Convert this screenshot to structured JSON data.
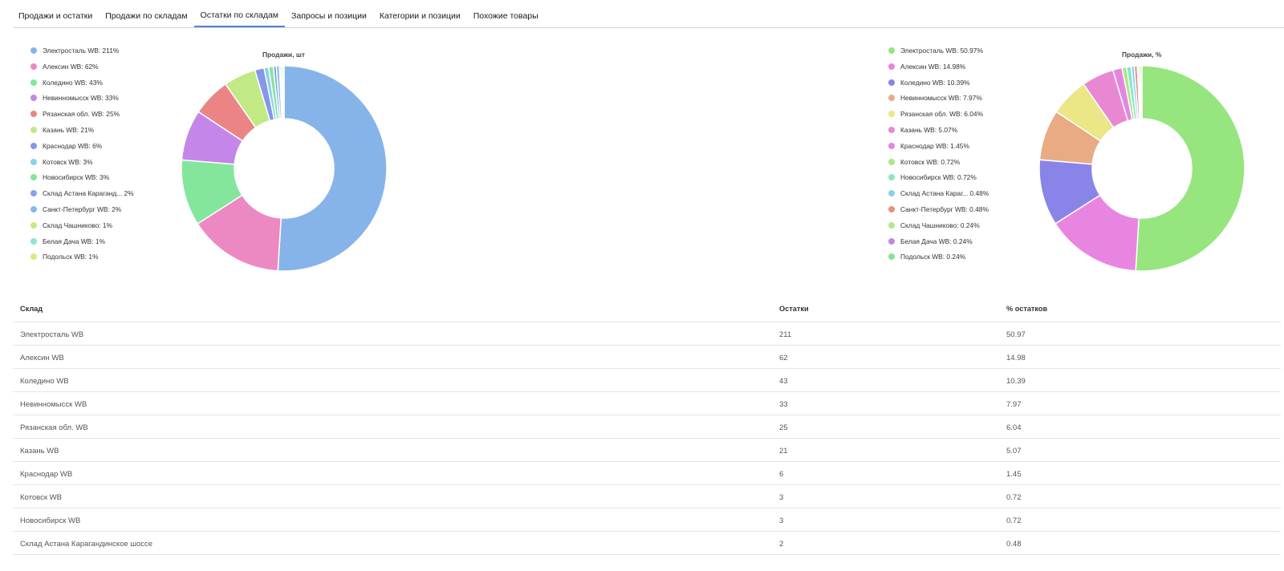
{
  "tabs": [
    {
      "label": "Продажи и остатки",
      "active": false
    },
    {
      "label": "Продажи по складам",
      "active": false
    },
    {
      "label": "Остатки по складам",
      "active": true
    },
    {
      "label": "Запросы и позиции",
      "active": false
    },
    {
      "label": "Категории и позиции",
      "active": false
    },
    {
      "label": "Похожие товары",
      "active": false
    }
  ],
  "chart_data": [
    {
      "type": "pie",
      "title": "Продажи, шт",
      "legend_position": "left",
      "labels": [
        "Электросталь WB: 211%",
        "Алексин WB: 62%",
        "Коледино WB: 43%",
        "Невинномысск WB: 33%",
        "Рязанская обл. WB: 25%",
        "Казань WB: 21%",
        "Краснодар WB: 6%",
        "Котовск WB: 3%",
        "Новосибирск WB: 3%",
        "Склад Астана Караганд...  2%",
        "Санкт-Петербург WB: 2%",
        "Склад Чашниково: 1%",
        "Белая Дача WB: 1%",
        "Подольск WB: 1%"
      ],
      "values": [
        211,
        62,
        43,
        33,
        25,
        21,
        6,
        3,
        3,
        2,
        2,
        1,
        1,
        1
      ],
      "colors": [
        "#86b4ea",
        "#ec89c2",
        "#84e69c",
        "#c486e8",
        "#eb8585",
        "#c1ea86",
        "#8597ea",
        "#8bd1ea",
        "#86e39b",
        "#87a2e8",
        "#82bce6",
        "#c6e985",
        "#8ae6cd",
        "#dde87f"
      ]
    },
    {
      "type": "pie",
      "title": "Продажи, %",
      "legend_position": "left",
      "labels": [
        "Электросталь WB: 50.97%",
        "Алексин WB: 14.98%",
        "Коледино WB: 10.39%",
        "Невинномысск WB: 7.97%",
        "Рязанская обл. WB: 6.04%",
        "Казань WB: 5.07%",
        "Краснодар WB: 1.45%",
        "Котовск WB: 0.72%",
        "Новосибирск WB: 0.72%",
        "Склад Астана Караг...  0.48%",
        "Санкт-Петербург WB: 0.48%",
        "Склад Чашниково: 0.24%",
        "Белая Дача WB: 0.24%",
        "Подольск WB: 0.24%"
      ],
      "values": [
        50.97,
        14.98,
        10.39,
        7.97,
        6.04,
        5.07,
        1.45,
        0.72,
        0.72,
        0.48,
        0.48,
        0.24,
        0.24,
        0.24
      ],
      "colors": [
        "#96e57f",
        "#e885e1",
        "#8884e8",
        "#e9ab84",
        "#ebe686",
        "#e888d2",
        "#e486e0",
        "#aae787",
        "#87e8c4",
        "#88d1ec",
        "#ec8f81",
        "#b5e787",
        "#be87e8",
        "#86e591"
      ]
    }
  ],
  "table": {
    "headers": [
      "Склад",
      "Остатки",
      "% остатков"
    ],
    "rows": [
      [
        "Электросталь WB",
        "211",
        "50.97"
      ],
      [
        "Алексин WB",
        "62",
        "14.98"
      ],
      [
        "Коледино WB",
        "43",
        "10.39"
      ],
      [
        "Невинномысск WB",
        "33",
        "7.97"
      ],
      [
        "Рязанская обл. WB",
        "25",
        "6.04"
      ],
      [
        "Казань WB",
        "21",
        "5.07"
      ],
      [
        "Краснодар WB",
        "6",
        "1.45"
      ],
      [
        "Котовск WB",
        "3",
        "0.72"
      ],
      [
        "Новосибирск WB",
        "3",
        "0.72"
      ],
      [
        "Склад Астана Карагандинское шоссе",
        "2",
        "0.48"
      ]
    ]
  }
}
